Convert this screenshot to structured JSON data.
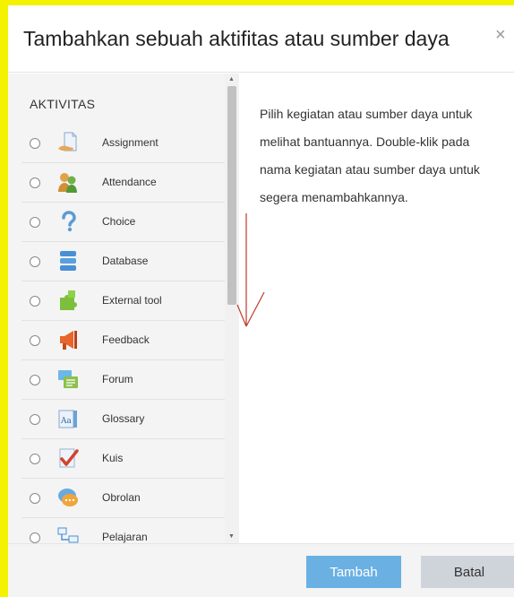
{
  "dialog": {
    "title": "Tambahkan sebuah aktifitas atau sumber daya",
    "close_label": "×"
  },
  "activities": {
    "section_title": "AKTIVITAS",
    "items": [
      {
        "label": "Assignment",
        "icon": "assignment-icon"
      },
      {
        "label": "Attendance",
        "icon": "attendance-icon"
      },
      {
        "label": "Choice",
        "icon": "choice-icon"
      },
      {
        "label": "Database",
        "icon": "database-icon"
      },
      {
        "label": "External tool",
        "icon": "external-tool-icon"
      },
      {
        "label": "Feedback",
        "icon": "feedback-icon"
      },
      {
        "label": "Forum",
        "icon": "forum-icon"
      },
      {
        "label": "Glossary",
        "icon": "glossary-icon"
      },
      {
        "label": "Kuis",
        "icon": "quiz-icon"
      },
      {
        "label": "Obrolan",
        "icon": "chat-icon"
      },
      {
        "label": "Pelajaran",
        "icon": "lesson-icon"
      }
    ]
  },
  "help": {
    "text": "Pilih kegiatan atau sumber daya untuk melihat bantuannya. Double-klik pada nama kegiatan atau sumber daya untuk segera menambahkannya."
  },
  "footer": {
    "add_label": "Tambah",
    "cancel_label": "Batal"
  },
  "colors": {
    "page_background": "#f5f200",
    "primary_button": "#6ab0e3",
    "secondary_button": "#ced4da",
    "annotation_arrow": "#c0392b"
  }
}
